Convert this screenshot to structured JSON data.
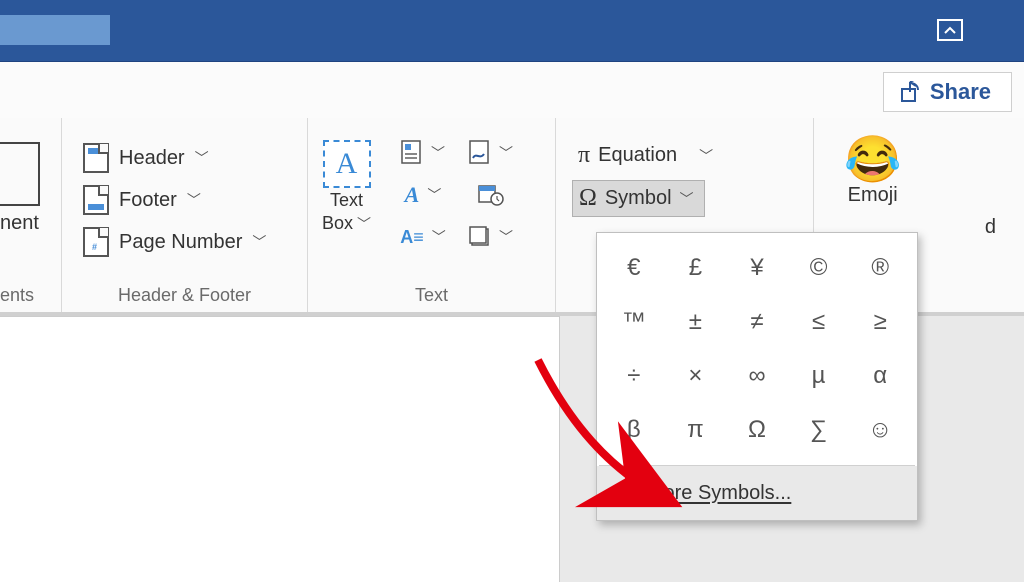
{
  "share": {
    "label": "Share"
  },
  "comments_group": {
    "partial_button_text": "nent",
    "partial_group_label": "ents"
  },
  "header_footer": {
    "group_label": "Header & Footer",
    "header": "Header",
    "footer": "Footer",
    "page_number": "Page Number"
  },
  "text_group": {
    "group_label": "Text",
    "text_box_line1": "Text",
    "text_box_line2": "Box"
  },
  "symbols_group": {
    "equation": "Equation",
    "symbol": "Symbol"
  },
  "emoji_group": {
    "label": "Emoji"
  },
  "stray_text": "d",
  "symbol_dropdown": {
    "cells": [
      "€",
      "£",
      "¥",
      "©",
      "®",
      "™",
      "±",
      "≠",
      "≤",
      "≥",
      "÷",
      "×",
      "∞",
      "µ",
      "α",
      "β",
      "π",
      "Ω",
      "∑",
      "☺"
    ],
    "more_label": "More Symbols..."
  }
}
